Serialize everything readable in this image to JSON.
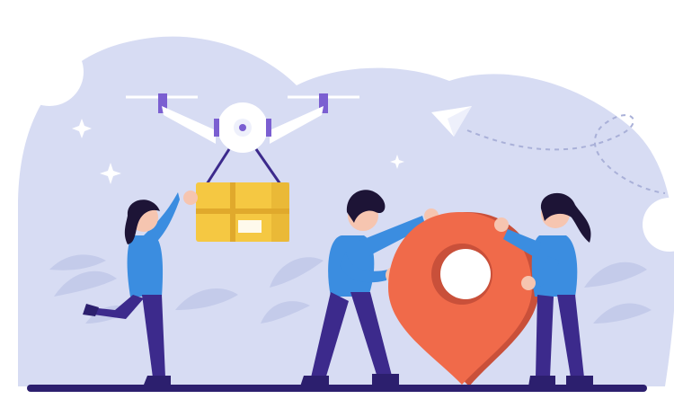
{
  "scene": {
    "colors": {
      "background": "#ffffff",
      "blob": "#d7dcf3",
      "plant": "#c4cbea",
      "drone_body": "#ffffff",
      "drone_accent": "#7b5fd1",
      "box": "#f5c842",
      "box_tape": "#e0a92c",
      "pin": "#f06a4a",
      "pin_shadow": "#c9503a",
      "shirt": "#3b8de0",
      "pants": "#3c2a8c",
      "hair": "#1d1436",
      "skin": "#f6c5b0",
      "ground": "#2c1f6e"
    },
    "icons": [
      "drone-icon",
      "package-box-icon",
      "location-pin-icon",
      "paper-plane-icon",
      "sparkle-icon"
    ]
  }
}
